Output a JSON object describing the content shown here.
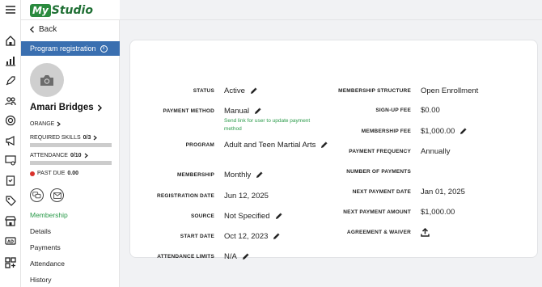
{
  "app": {
    "logo_my": "My",
    "logo_studio": "Studio"
  },
  "rail_icons": [
    "menu-icon",
    "home-icon",
    "chart-icon",
    "rocket-icon",
    "people-icon",
    "badge-icon",
    "megaphone-icon",
    "settings-screen-icon",
    "clipboard-icon",
    "tag-icon",
    "store-icon",
    "ad-icon",
    "apps-icon"
  ],
  "panel": {
    "back_label": "Back",
    "program_registration_label": "Program registration",
    "student_name": "Amari Bridges",
    "rank": "ORANGE",
    "required_skills_label": "REQUIRED SKILLS",
    "required_skills_value": "0/3",
    "required_skills_progress": 0,
    "attendance_label": "ATTENDANCE",
    "attendance_value": "0/10",
    "attendance_progress": 0,
    "past_due_label": "PAST DUE",
    "past_due_value": "0.00",
    "nav": [
      {
        "label": "Membership",
        "active": true
      },
      {
        "label": "Details",
        "active": false
      },
      {
        "label": "Payments",
        "active": false
      },
      {
        "label": "Attendance",
        "active": false
      },
      {
        "label": "History",
        "active": false
      }
    ]
  },
  "details": {
    "left": [
      {
        "label": "STATUS",
        "value": "Active",
        "editable": true
      },
      {
        "label": "PAYMENT METHOD",
        "value": "Manual",
        "editable": true,
        "note": "Send link for user to update payment method"
      },
      {
        "label": "PROGRAM",
        "value": "Adult and Teen Martial Arts",
        "editable": true
      },
      {
        "label": "MEMBERSHIP",
        "value": "Monthly",
        "editable": true
      },
      {
        "label": "REGISTRATION DATE",
        "value": "Jun 12, 2025",
        "editable": false
      },
      {
        "label": "SOURCE",
        "value": "Not Specified",
        "editable": true
      },
      {
        "label": "START DATE",
        "value": "Oct 12, 2023",
        "editable": true
      },
      {
        "label": "ATTENDANCE LIMITS",
        "value": "N/A",
        "editable": true
      }
    ],
    "right": [
      {
        "label": "MEMBERSHIP STRUCTURE",
        "value": "Open Enrollment",
        "editable": false
      },
      {
        "label": "SIGN-UP FEE",
        "value": "$0.00",
        "editable": false
      },
      {
        "label": "MEMBERSHIP FEE",
        "value": "$1,000.00",
        "editable": true
      },
      {
        "label": "PAYMENT FREQUENCY",
        "value": "Annually",
        "editable": false
      },
      {
        "label": "NUMBER OF PAYMENTS",
        "value": "",
        "editable": false
      },
      {
        "label": "NEXT PAYMENT DATE",
        "value": "Jan 01, 2025",
        "editable": false
      },
      {
        "label": "NEXT PAYMENT AMOUNT",
        "value": "$1,000.00",
        "editable": false
      },
      {
        "label": "AGREEMENT & WAIVER",
        "value": "",
        "editable": false,
        "icon": "upload-icon"
      }
    ]
  },
  "colors": {
    "accent_green": "#2a9a49",
    "brand_blue": "#3a6fb0",
    "past_due_red": "#d9312b",
    "page_gray": "#f1f2f4"
  }
}
